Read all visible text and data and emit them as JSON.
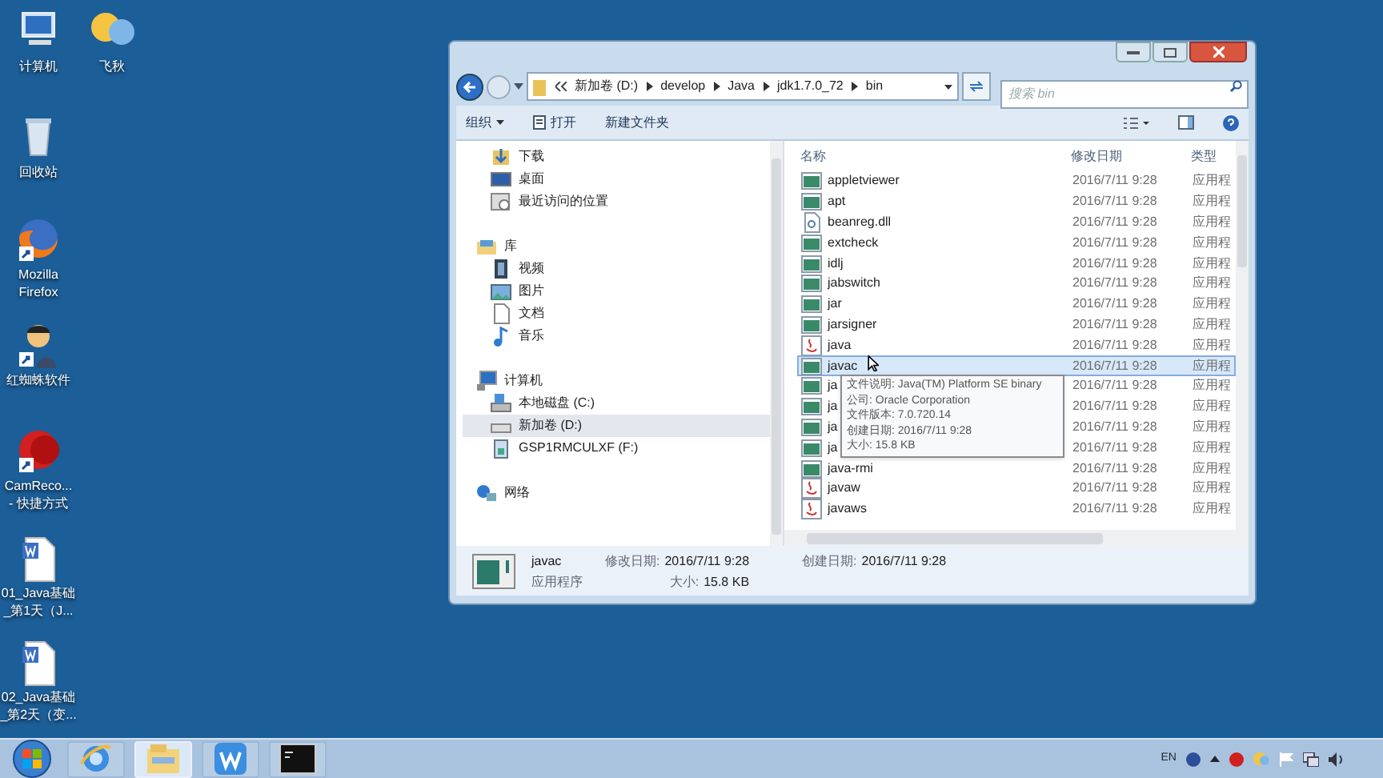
{
  "desktop_icons": [
    {
      "kind": "computer",
      "lines": [
        "计算机"
      ]
    },
    {
      "kind": "chat",
      "lines": [
        "飞秋"
      ]
    },
    {
      "kind": "recycle",
      "lines": [
        "回收站"
      ]
    },
    {
      "kind": "firefox",
      "lines": [
        "Mozilla",
        "Firefox"
      ],
      "shortcut": true
    },
    {
      "kind": "person",
      "lines": [
        "红蜘蛛软件"
      ],
      "shortcut": true
    },
    {
      "kind": "record",
      "lines": [
        "CamReco...",
        "- 快捷方式"
      ],
      "shortcut": true
    },
    {
      "kind": "doc",
      "lines": [
        "01_Java基础",
        "_第1天（J..."
      ]
    },
    {
      "kind": "doc",
      "lines": [
        "02_Java基础",
        "_第2天（变..."
      ]
    }
  ],
  "explorer": {
    "address": [
      "新加卷 (D:)",
      "develop",
      "Java",
      "jdk1.7.0_72",
      "bin"
    ],
    "search": {
      "placeholder": "搜索 bin"
    },
    "toolbar": [
      {
        "label": "组织",
        "dropdown": true,
        "icon": false
      },
      {
        "label": "打开",
        "dropdown": false,
        "icon": true
      },
      {
        "label": "新建文件夹",
        "dropdown": false,
        "icon": false
      }
    ],
    "nav": [
      {
        "children": [
          {
            "label": "下载",
            "kind": "download",
            "selected": false
          },
          {
            "label": "桌面",
            "kind": "desktop",
            "selected": false
          },
          {
            "label": "最近访问的位置",
            "kind": "recent",
            "selected": false
          }
        ]
      },
      {
        "label": "库",
        "kind": "library",
        "selected": false,
        "children": [
          {
            "label": "视频",
            "kind": "video",
            "selected": false
          },
          {
            "label": "图片",
            "kind": "picture",
            "selected": false
          },
          {
            "label": "文档",
            "kind": "document",
            "selected": false
          },
          {
            "label": "音乐",
            "kind": "music",
            "selected": false
          }
        ]
      },
      {
        "label": "计算机",
        "kind": "computer",
        "selected": false,
        "children": [
          {
            "label": "本地磁盘 (C:)",
            "kind": "sysdrive",
            "selected": false
          },
          {
            "label": "新加卷 (D:)",
            "kind": "drive",
            "selected": true
          },
          {
            "label": "GSP1RMCULXF (F:)",
            "kind": "usb",
            "selected": false
          }
        ]
      },
      {
        "label": "网络",
        "kind": "network",
        "selected": false
      }
    ],
    "columns": [
      "名称",
      "修改日期",
      "类型"
    ],
    "rows": [
      {
        "name": "appletviewer",
        "date": "2016/7/11 9:28",
        "type": "应用程",
        "kind": "exe",
        "selected": false
      },
      {
        "name": "apt",
        "date": "2016/7/11 9:28",
        "type": "应用程",
        "kind": "exe",
        "selected": false
      },
      {
        "name": "beanreg.dll",
        "date": "2016/7/11 9:28",
        "type": "应用程",
        "kind": "dll",
        "selected": false
      },
      {
        "name": "extcheck",
        "date": "2016/7/11 9:28",
        "type": "应用程",
        "kind": "exe",
        "selected": false
      },
      {
        "name": "idlj",
        "date": "2016/7/11 9:28",
        "type": "应用程",
        "kind": "exe",
        "selected": false
      },
      {
        "name": "jabswitch",
        "date": "2016/7/11 9:28",
        "type": "应用程",
        "kind": "exe",
        "selected": false
      },
      {
        "name": "jar",
        "date": "2016/7/11 9:28",
        "type": "应用程",
        "kind": "exe",
        "selected": false
      },
      {
        "name": "jarsigner",
        "date": "2016/7/11 9:28",
        "type": "应用程",
        "kind": "exe",
        "selected": false
      },
      {
        "name": "java",
        "date": "2016/7/11 9:28",
        "type": "应用程",
        "kind": "java",
        "selected": false
      },
      {
        "name": "javac",
        "date": "2016/7/11 9:28",
        "type": "应用程",
        "kind": "exe",
        "selected": true
      },
      {
        "name": "ja",
        "date": "2016/7/11 9:28",
        "type": "应用程",
        "kind": "exe",
        "selected": false
      },
      {
        "name": "ja",
        "date": "2016/7/11 9:28",
        "type": "应用程",
        "kind": "exe",
        "selected": false
      },
      {
        "name": "ja",
        "date": "2016/7/11 9:28",
        "type": "应用程",
        "kind": "exe",
        "selected": false
      },
      {
        "name": "ja",
        "date": "2016/7/11 9:28",
        "type": "应用程",
        "kind": "exe",
        "selected": false
      },
      {
        "name": "java-rmi",
        "date": "2016/7/11 9:28",
        "type": "应用程",
        "kind": "exe",
        "selected": false
      },
      {
        "name": "javaw",
        "date": "2016/7/11 9:28",
        "type": "应用程",
        "kind": "java",
        "selected": false
      },
      {
        "name": "javaws",
        "date": "2016/7/11 9:28",
        "type": "应用程",
        "kind": "java",
        "selected": false
      }
    ],
    "tooltip": [
      "文件说明: Java(TM) Platform SE binary",
      "公司: Oracle Corporation",
      "文件版本: 7.0.720.14",
      "创建日期: 2016/7/11 9:28",
      "大小: 15.8 KB"
    ],
    "details": {
      "name": "javac",
      "type": "应用程序",
      "fields": [
        {
          "label": "修改日期:",
          "value": "2016/7/11 9:28"
        },
        {
          "label": "创建日期:",
          "value": "2016/7/11 9:28"
        },
        {
          "label": "大小:",
          "value": "15.8 KB"
        }
      ]
    }
  },
  "taskbar": {
    "apps": [
      {
        "kind": "ie",
        "selected": false
      },
      {
        "kind": "explorer",
        "selected": true
      },
      {
        "kind": "wps",
        "selected": false
      },
      {
        "kind": "cmd",
        "selected": false
      }
    ],
    "tray_language": "EN"
  }
}
